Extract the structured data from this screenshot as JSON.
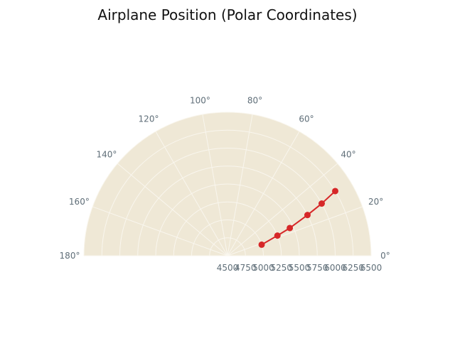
{
  "chart_data": {
    "type": "line",
    "projection": "polar",
    "title": "Airplane Position (Polar Coordinates)",
    "theta_range_deg": [
      0,
      180
    ],
    "r_range": [
      4500,
      6500
    ],
    "grid": true,
    "theta_ticks": [
      "0°",
      "20°",
      "40°",
      "60°",
      "80°",
      "100°",
      "120°",
      "140°",
      "160°",
      "180°"
    ],
    "theta_tick_values": [
      0,
      20,
      40,
      60,
      80,
      100,
      120,
      140,
      160,
      180
    ],
    "r_ticks": [
      "4500",
      "4750",
      "5000",
      "5250",
      "5500",
      "5750",
      "6000",
      "6250",
      "6500"
    ],
    "r_tick_values": [
      4500,
      4750,
      5000,
      5250,
      5500,
      5750,
      6000,
      6250,
      6500
    ],
    "series": [
      {
        "theta_deg": [
          18,
          22,
          24,
          27,
          29,
          31
        ],
        "r": [
          5000,
          5250,
          5450,
          5750,
          6000,
          6250
        ],
        "color": "#d62728",
        "marker": "circle"
      }
    ],
    "background_color": "#efe8d6",
    "grid_color": "#f9f6ee"
  }
}
